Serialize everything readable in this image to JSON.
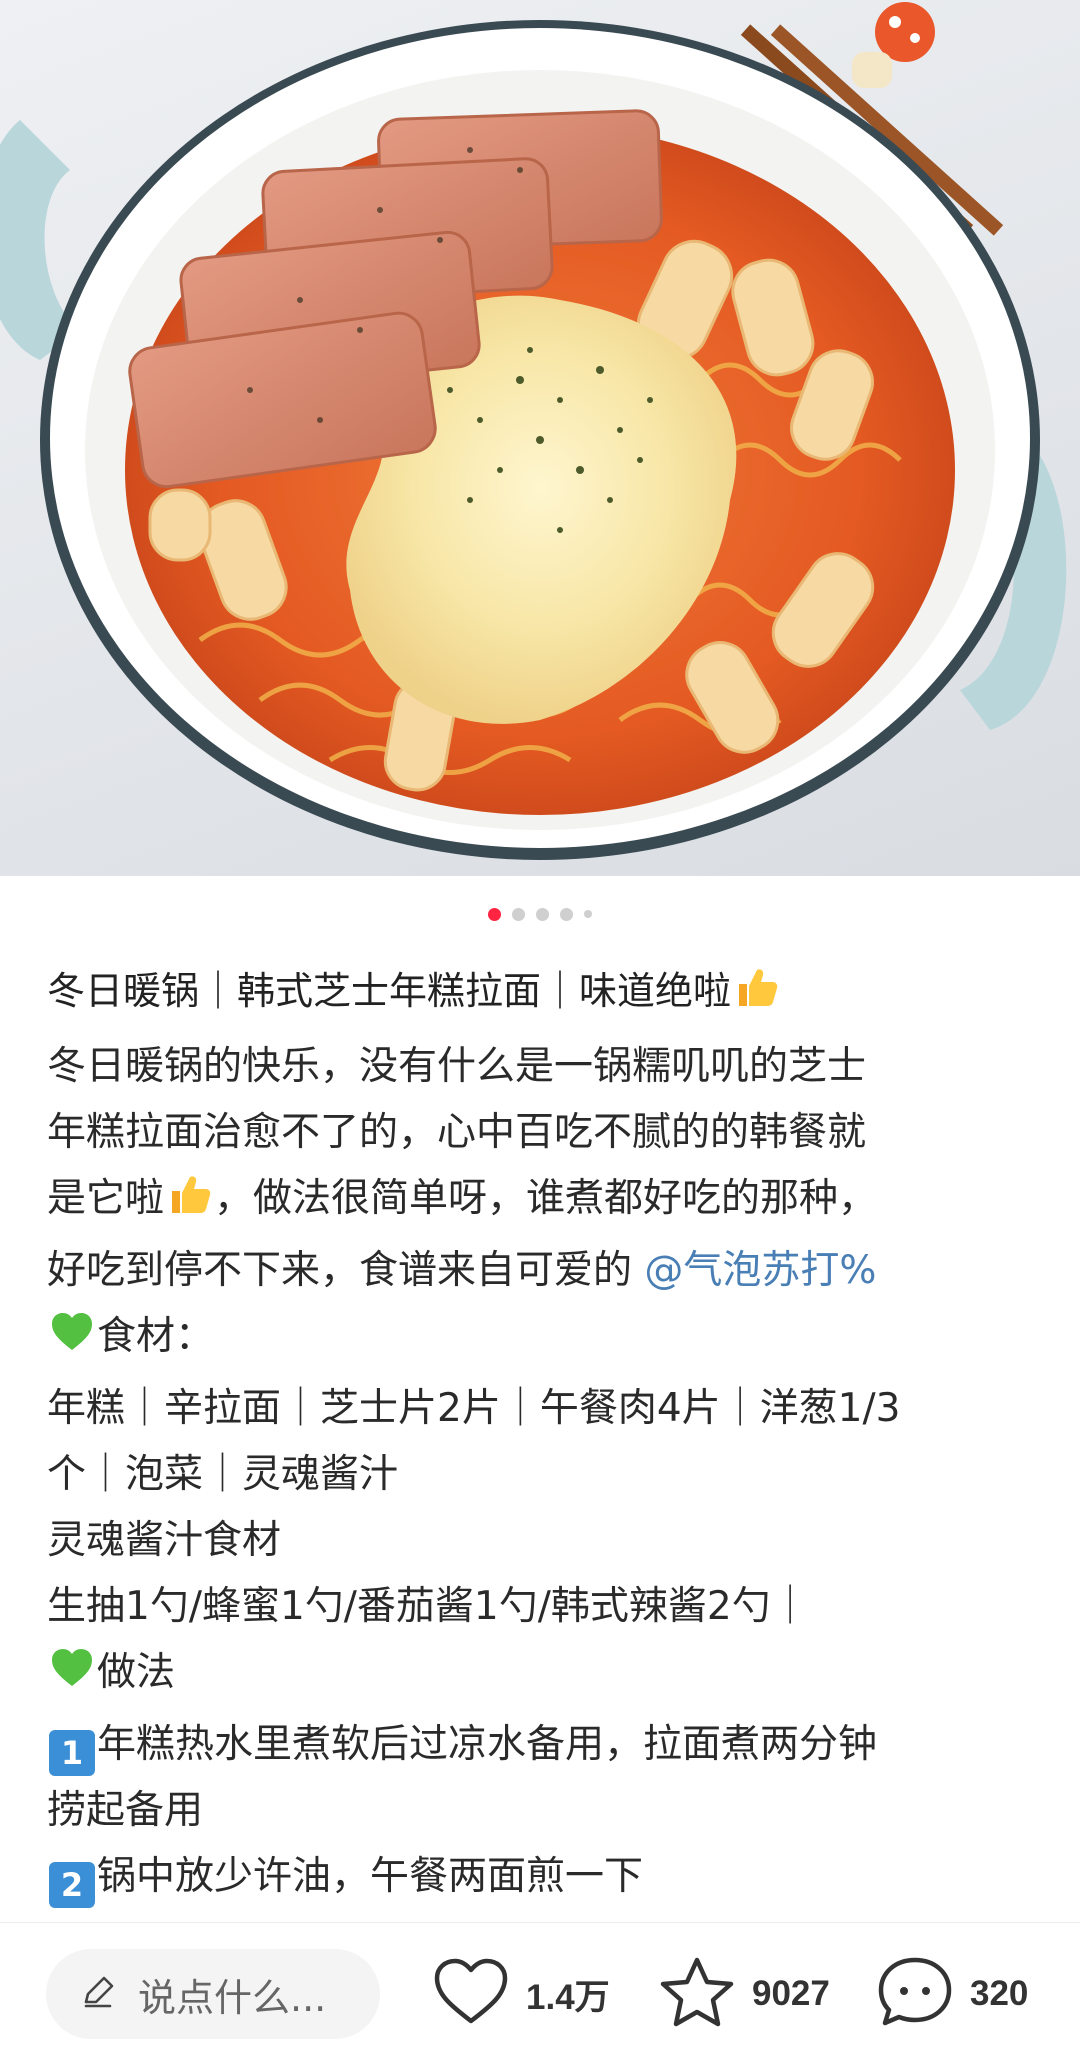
{
  "carousel": {
    "total": 5,
    "active_index": 0
  },
  "note": {
    "title": "冬日暖锅｜韩式芝士年糕拉面｜味道绝啦",
    "lines": {
      "l1": "冬日暖锅的快乐，没有什么是一锅糯叽叽的芝士",
      "l2": "年糕拉面治愈不了的，心中百吃不腻的的韩餐就",
      "l3a": "是它啦",
      "l3b": "，做法很简单呀，谁煮都好吃的那种，",
      "l4": "好吃到停不下来，食谱来自可爱的 ",
      "mention": "@气泡苏打%",
      "l5": "食材：",
      "l6": "年糕｜辛拉面｜芝士片2片｜午餐肉4片｜洋葱1/3",
      "l7": "个｜泡菜｜灵魂酱汁",
      "l8": "灵魂酱汁食材",
      "l9": "生抽1勺/蜂蜜1勺/番茄酱1勺/韩式辣酱2勺｜",
      "l10": "做法",
      "step1_num": "1",
      "l11": "年糕热水里煮软后过凉水备用，拉面煮两分钟",
      "l12": "捞起备用",
      "step2_num": "2",
      "l13": "锅中放少许油，午餐两面煎一下"
    }
  },
  "bottom_bar": {
    "comment_placeholder": "说点什么...",
    "likes": "1.4万",
    "collects": "9027",
    "comments": "320"
  },
  "colors": {
    "accent": "#ff2442",
    "mention": "#4a7fb5",
    "pot_handle": "#b9d6db"
  }
}
